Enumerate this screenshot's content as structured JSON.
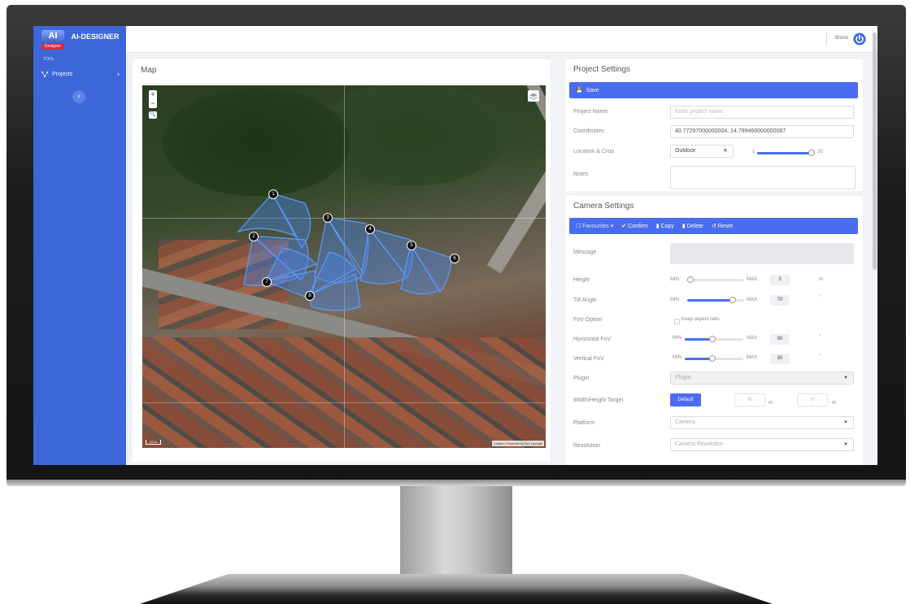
{
  "app": {
    "logo_text": "AI",
    "logo_sub": "Designer",
    "brand": "AI-DESIGNER"
  },
  "sidebar": {
    "section_label": "TOOL",
    "items": [
      {
        "label": "Projects",
        "icon": "network-icon"
      }
    ],
    "collapse_icon": "chevron-left-icon"
  },
  "topbar": {
    "user": "Bruno",
    "power_icon": "power-icon",
    "accent": "#3e66db"
  },
  "map_panel": {
    "title": "Map",
    "zoom_in": "+",
    "zoom_out": "−",
    "attribution": "Leaflet | Powered by Esri | google",
    "scale_label": "20 m",
    "markers": [
      "1",
      "2",
      "3",
      "4",
      "5",
      "6",
      "7",
      "8"
    ]
  },
  "project_settings": {
    "title": "Project Settings",
    "save_label": "Save",
    "fields": {
      "name_label": "Project Name",
      "name_placeholder": "Enter project name",
      "coords_label": "Coordinates",
      "coords_value": "40.77297000000004, 14.799460000000067",
      "location_label": "Location & Crop",
      "location_value": "Outdoor",
      "crop_min": "1",
      "crop_max": "20",
      "crop_level": 0.95,
      "notes_label": "Notes"
    }
  },
  "camera_settings": {
    "title": "Camera Settings",
    "toolbar": {
      "favourites": "Favourites",
      "confirm": "Confirm",
      "copy": "Copy",
      "delete": "Delete",
      "reset": "Reset"
    },
    "message_label": "Message",
    "height": {
      "label": "Height",
      "min": "MIN",
      "max": "MAX",
      "value": "3",
      "unit": "m",
      "level": 0.05
    },
    "tilt": {
      "label": "Tilt Angle",
      "min": "MIN",
      "max": "MAX",
      "value": "70",
      "unit": "°",
      "level": 0.8
    },
    "fov_option": {
      "label": "FoV Option",
      "checkbox_label": "Keep aspect ratio"
    },
    "hfov": {
      "label": "Horizontal FoV",
      "min": "MIN",
      "max": "MAX",
      "value": "90",
      "unit": "°",
      "level": 0.47
    },
    "vfov": {
      "label": "Vertical FoV",
      "min": "MIN",
      "max": "MAX",
      "value": "90",
      "unit": "°",
      "level": 0.47
    },
    "plugin": {
      "label": "Plugin",
      "placeholder": "Plugin"
    },
    "wh_target": {
      "label": "Width/Height Target",
      "default_btn": "Default",
      "w": "W",
      "h": "H",
      "unit": "m"
    },
    "platform": {
      "label": "Platform",
      "placeholder": "Camera"
    },
    "resolution": {
      "label": "Resolution",
      "placeholder": "Camera Resolution"
    }
  }
}
